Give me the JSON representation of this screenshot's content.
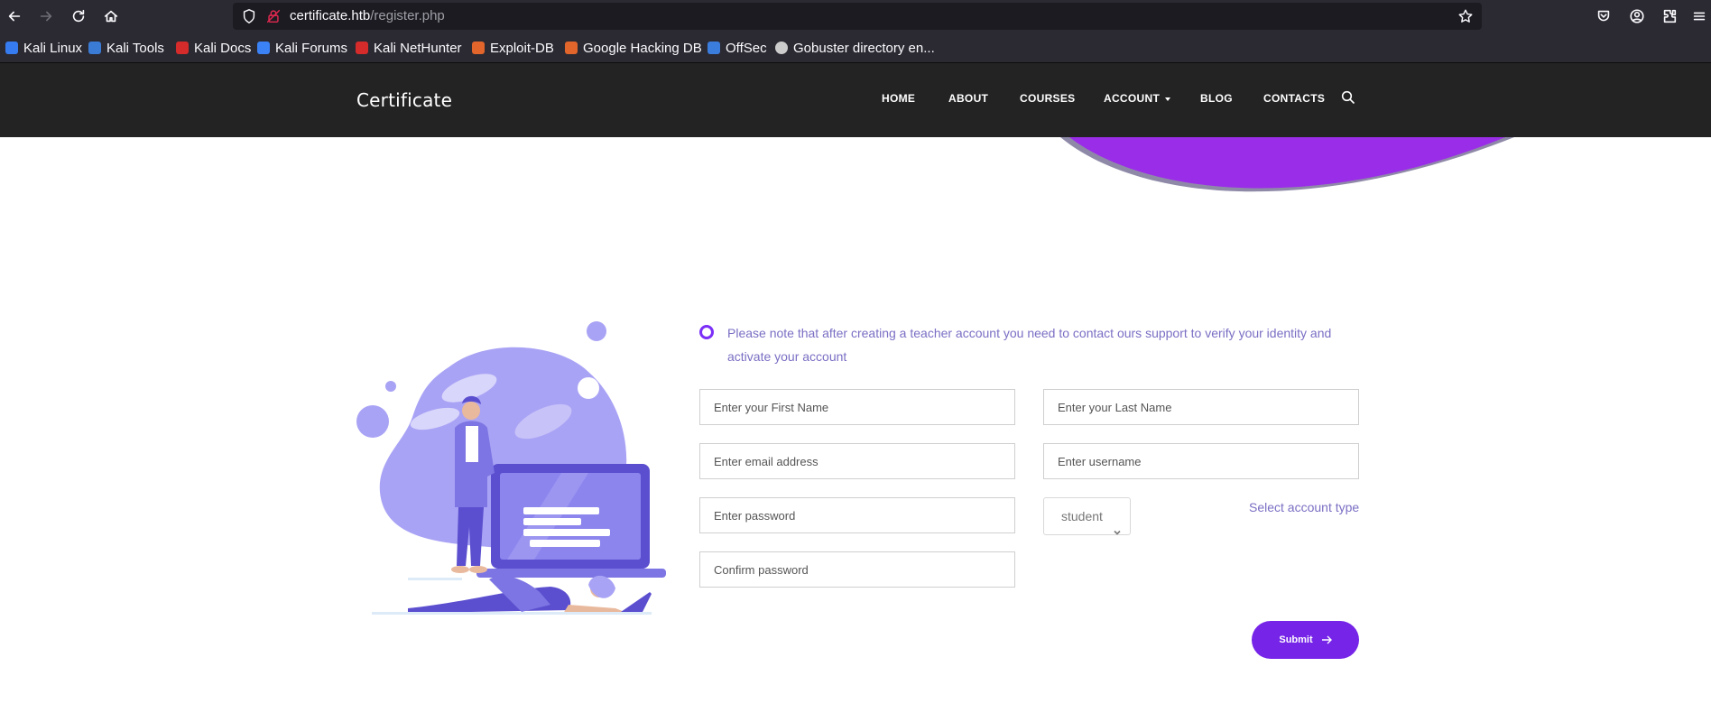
{
  "browser": {
    "url_host": "certificate.htb",
    "url_path": "/register.php",
    "bookmarks": [
      {
        "label": "Kali Linux",
        "color": "#367bf0"
      },
      {
        "label": "Kali Tools",
        "color": "#3a7bd5"
      },
      {
        "label": "Kali Docs",
        "color": "#d52b2b"
      },
      {
        "label": "Kali Forums",
        "color": "#3b82f6"
      },
      {
        "label": "Kali NetHunter",
        "color": "#d52b2b"
      },
      {
        "label": "Exploit-DB",
        "color": "#e2652b"
      },
      {
        "label": "Google Hacking DB",
        "color": "#e2652b"
      },
      {
        "label": "OffSec",
        "color": "#3b7ddd"
      },
      {
        "label": "Gobuster directory en...",
        "color": "#cccccc"
      }
    ]
  },
  "header": {
    "brand": "Certificate",
    "nav": [
      "HOME",
      "ABOUT",
      "COURSES",
      "ACCOUNT",
      "BLOG",
      "CONTACTS"
    ]
  },
  "form": {
    "note": "Please note that after creating a teacher account you need to contact ours support to verify your identity and activate your account",
    "first_name_placeholder": "Enter your First Name",
    "last_name_placeholder": "Enter your Last Name",
    "email_placeholder": "Enter email address",
    "username_placeholder": "Enter username",
    "password_placeholder": "Enter password",
    "confirm_password_placeholder": "Confirm password",
    "account_type_value": "student",
    "account_type_label": "Select account type",
    "submit_label": "Submit"
  },
  "colors": {
    "accent": "#7524e8",
    "header_bg": "#232323",
    "illustration_primary": "#a9a3f5",
    "illustration_dark": "#5b4fcf"
  }
}
